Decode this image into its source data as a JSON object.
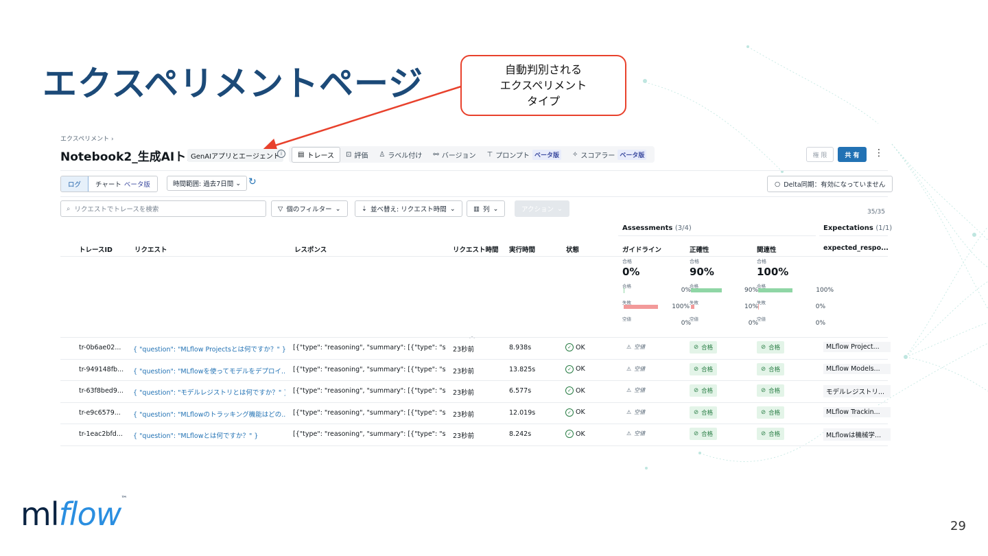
{
  "slide": {
    "title": "エクスペリメントページ",
    "callout_lines": [
      "自動判別される",
      "エクスペリメント",
      "タイプ"
    ],
    "page_number": "29",
    "logo": {
      "ml": "ml",
      "flow": "flow",
      "tm": "™"
    }
  },
  "header": {
    "breadcrumb": "エクスペリメント  ›",
    "title": "Notebook2_生成AIト...",
    "type_badge": "GenAIアプリとエージェント",
    "perm_button": "権 限",
    "share_button": "共 有"
  },
  "tabs": [
    {
      "label": "トレース",
      "icon": "list-icon",
      "active": true
    },
    {
      "label": "評価",
      "icon": "eval-icon",
      "active": false
    },
    {
      "label": "ラベル付け",
      "icon": "user-icon",
      "active": false
    },
    {
      "label": "バージョン",
      "icon": "branch-icon",
      "active": false
    },
    {
      "label": "プロンプト",
      "icon": "prompt-icon",
      "active": false,
      "beta": "ベータ版"
    },
    {
      "label": "スコアラー",
      "icon": "sparkle-icon",
      "active": false,
      "beta": "ベータ版"
    }
  ],
  "toolbar": {
    "log": "ログ",
    "chart": "チャート",
    "chart_beta": "ベータ版",
    "time_range": "時間範囲: 過去7日間",
    "delta_sync": "Delta同期：有効になっていません",
    "search_placeholder": "リクエストでトレースを検索",
    "filter": "個のフィルター",
    "sort": "並べ替え: リクエスト時間",
    "columns": "列",
    "actions": "アクション",
    "count": "35/35"
  },
  "groups": {
    "assessments": "Assessments",
    "assessments_count": "(3/4)",
    "expectations": "Expectations",
    "expectations_count": "(1/1)"
  },
  "columns": [
    "トレースID",
    "リクエスト",
    "レスポンス",
    "リクエスト時間",
    "実行時間",
    "状態",
    "ガイドライン",
    "正確性",
    "関連性",
    "expected_respo..."
  ],
  "summaries": [
    {
      "label": "合格",
      "value": "0%",
      "pass_label": "合格",
      "pass_pct": "0%",
      "pass": 0,
      "fail_label": "失敗",
      "fail_pct": "100%",
      "fail": 1.0,
      "null_label": "空値",
      "null_pct": "0%"
    },
    {
      "label": "合格",
      "value": "90%",
      "pass_label": "合格",
      "pass_pct": "90%",
      "pass": 0.9,
      "fail_label": "失敗",
      "fail_pct": "10%",
      "fail": 0.1,
      "null_label": "空値",
      "null_pct": "0%"
    },
    {
      "label": "合格",
      "value": "100%",
      "pass_label": "合格",
      "pass_pct": "100%",
      "pass": 1.0,
      "fail_label": "失敗",
      "fail_pct": "0%",
      "fail": 0,
      "null_label": "空値",
      "null_pct": "0%"
    }
  ],
  "rows": [
    {
      "id": "tr-0b6ae02...",
      "request": "{ \"question\": \"MLflow Projectsとは何ですか？\" }",
      "response": "[{\"type\": \"reasoning\", \"summary\": [{\"type\": \"s...",
      "time": "23秒前",
      "duration": "8.938s",
      "status": "OK",
      "guideline": "空値",
      "correct": "合格",
      "relevance": "合格",
      "expected": "MLflow Project..."
    },
    {
      "id": "tr-949148fb...",
      "request": "{ \"question\": \"MLflowを使ってモデルをデプロイ...",
      "response": "[{\"type\": \"reasoning\", \"summary\": [{\"type\": \"s...",
      "time": "23秒前",
      "duration": "13.825s",
      "status": "OK",
      "guideline": "空値",
      "correct": "合格",
      "relevance": "合格",
      "expected": "MLflow Models..."
    },
    {
      "id": "tr-63f8bed9...",
      "request": "{ \"question\": \"モデルレジストリとは何ですか？\" }",
      "response": "[{\"type\": \"reasoning\", \"summary\": [{\"type\": \"s...",
      "time": "23秒前",
      "duration": "6.577s",
      "status": "OK",
      "guideline": "空値",
      "correct": "合格",
      "relevance": "合格",
      "expected": "モデルレジストリ..."
    },
    {
      "id": "tr-e9c6579...",
      "request": "{ \"question\": \"MLflowのトラッキング機能はどの...",
      "response": "[{\"type\": \"reasoning\", \"summary\": [{\"type\": \"s...",
      "time": "23秒前",
      "duration": "12.019s",
      "status": "OK",
      "guideline": "空値",
      "correct": "合格",
      "relevance": "合格",
      "expected": "MLflow Trackin..."
    },
    {
      "id": "tr-1eac2bfd...",
      "request": "{ \"question\": \"MLflowとは何ですか？\" }",
      "response": "[{\"type\": \"reasoning\", \"summary\": [{\"type\": \"s...",
      "time": "23秒前",
      "duration": "8.242s",
      "status": "OK",
      "guideline": "空値",
      "correct": "合格",
      "relevance": "合格",
      "expected": "MLflowは機械学..."
    }
  ],
  "colors": {
    "title": "#1c4a78",
    "callout": "#e8412c",
    "accent": "#2272b4",
    "pass_bar": "#8fd6a5",
    "fail_bar": "#f29a9a",
    "ok": "#277c43"
  }
}
